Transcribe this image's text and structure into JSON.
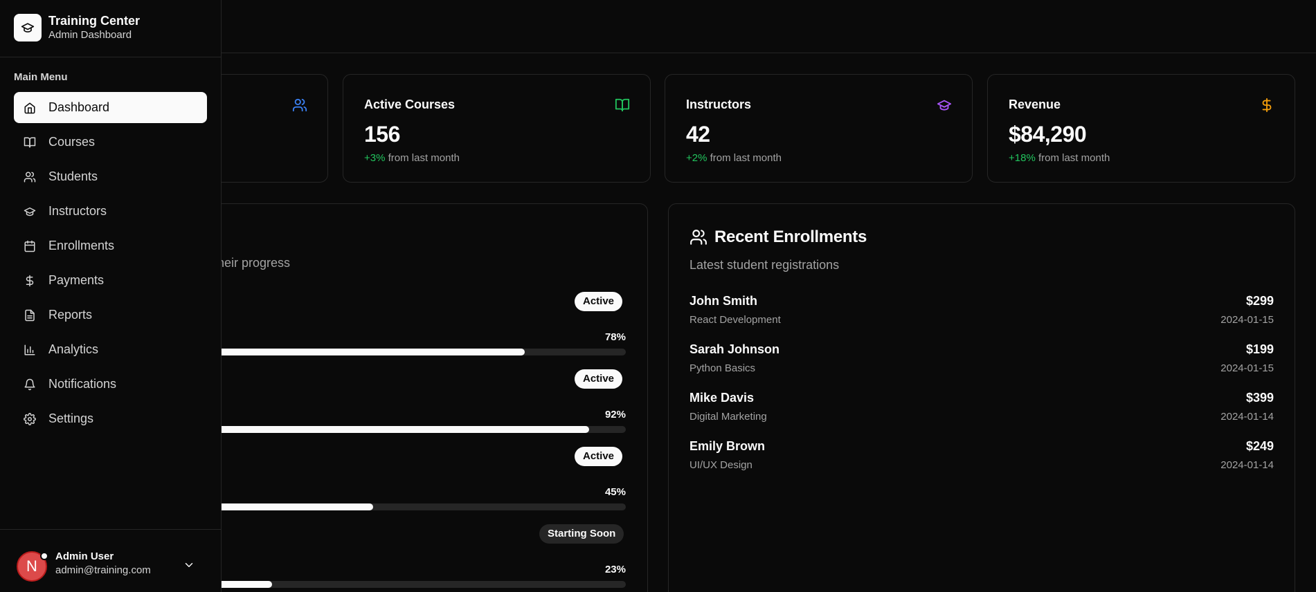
{
  "brand": {
    "title": "Training Center",
    "subtitle": "Admin Dashboard"
  },
  "sidebar": {
    "menu_label": "Main Menu",
    "items": [
      {
        "label": "Dashboard",
        "icon": "home-icon",
        "active": true
      },
      {
        "label": "Courses",
        "icon": "book-icon"
      },
      {
        "label": "Students",
        "icon": "users-icon"
      },
      {
        "label": "Instructors",
        "icon": "graduation-cap-icon"
      },
      {
        "label": "Enrollments",
        "icon": "calendar-icon"
      },
      {
        "label": "Payments",
        "icon": "dollar-icon"
      },
      {
        "label": "Reports",
        "icon": "file-text-icon"
      },
      {
        "label": "Analytics",
        "icon": "bar-chart-icon"
      },
      {
        "label": "Notifications",
        "icon": "bell-icon"
      },
      {
        "label": "Settings",
        "icon": "gear-icon"
      }
    ],
    "user": {
      "initial": "N",
      "name": "Admin User",
      "email": "admin@training.com"
    }
  },
  "stats": [
    {
      "label": "Active Courses",
      "value": "156",
      "change": "+3%",
      "suffix": "from last month",
      "icon": "book-icon",
      "color": "#22c55e"
    },
    {
      "label": "Instructors",
      "value": "42",
      "change": "+2%",
      "suffix": "from last month",
      "icon": "graduation-cap-icon",
      "color": "#a855f7"
    },
    {
      "label": "Revenue",
      "value": "$84,290",
      "change": "+18%",
      "suffix": "from last month",
      "icon": "dollar-icon",
      "color": "#f59e0b"
    }
  ],
  "first_stat_icon_color": "#3b82f6",
  "courses": {
    "subtitle_fragment": "l their progress",
    "items": [
      {
        "status": "Active",
        "progress": 78
      },
      {
        "status": "Active",
        "progress": 92
      },
      {
        "status": "Active",
        "progress": 45
      },
      {
        "status": "Starting Soon",
        "progress": 23
      }
    ]
  },
  "enrollments": {
    "title": "Recent Enrollments",
    "subtitle": "Latest student registrations",
    "items": [
      {
        "name": "John Smith",
        "course": "React Development",
        "amount": "$299",
        "date": "2024-01-15"
      },
      {
        "name": "Sarah Johnson",
        "course": "Python Basics",
        "amount": "$199",
        "date": "2024-01-15"
      },
      {
        "name": "Mike Davis",
        "course": "Digital Marketing",
        "amount": "$399",
        "date": "2024-01-14"
      },
      {
        "name": "Emily Brown",
        "course": "UI/UX Design",
        "amount": "$249",
        "date": "2024-01-14"
      }
    ]
  }
}
